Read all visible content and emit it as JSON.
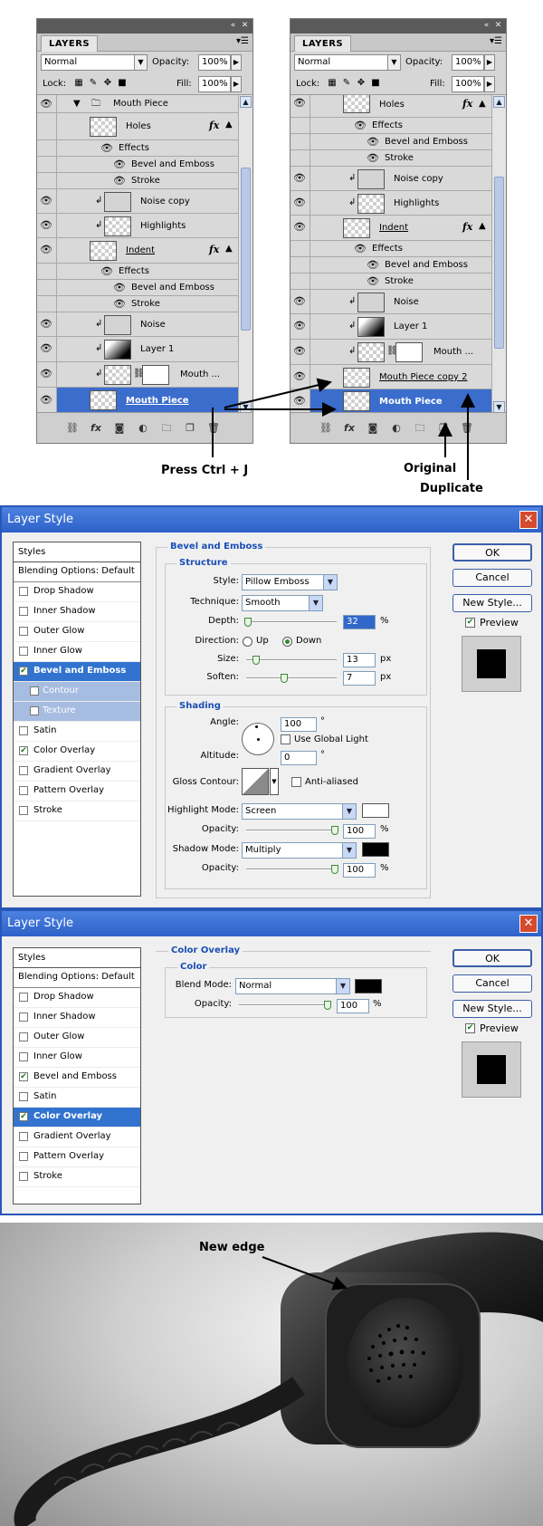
{
  "layers_left": {
    "tab": "LAYERS",
    "blend_mode": "Normal",
    "opacity_label": "Opacity:",
    "opacity_value": "100%",
    "lock_label": "Lock:",
    "fill_label": "Fill:",
    "fill_value": "100%",
    "rows": [
      "Mouth Piece",
      "Holes",
      "Effects",
      "Bevel and Emboss",
      "Stroke",
      "Noise  copy",
      "Highlights",
      "Indent",
      "Effects",
      "Bevel and Emboss",
      "Stroke",
      "Noise",
      "Layer 1",
      "Mouth ...",
      "Mouth Piece"
    ]
  },
  "layers_right": {
    "tab": "LAYERS",
    "blend_mode": "Normal",
    "opacity_label": "Opacity:",
    "opacity_value": "100%",
    "lock_label": "Lock:",
    "fill_label": "Fill:",
    "fill_value": "100%",
    "rows": [
      "Holes",
      "Effects",
      "Bevel and Emboss",
      "Stroke",
      "Noise  copy",
      "Highlights",
      "Indent",
      "Effects",
      "Bevel and Emboss",
      "Stroke",
      "Noise",
      "Layer 1",
      "Mouth ...",
      "Mouth Piece copy 2",
      "Mouth Piece"
    ]
  },
  "annotations": {
    "press": "Press Ctrl + J",
    "original": "Original",
    "duplicate": "Duplicate",
    "new_edge": "New edge"
  },
  "dialog1": {
    "title": "Layer Style",
    "styles_header": "Styles",
    "blending": "Blending Options: Default",
    "items": [
      "Drop Shadow",
      "Inner Shadow",
      "Outer Glow",
      "Inner Glow",
      "Bevel and Emboss",
      "Contour",
      "Texture",
      "Satin",
      "Color Overlay",
      "Gradient Overlay",
      "Pattern Overlay",
      "Stroke"
    ],
    "section": "Bevel and Emboss",
    "structure": "Structure",
    "style_label": "Style:",
    "style_value": "Pillow Emboss",
    "technique_label": "Technique:",
    "technique_value": "Smooth",
    "depth_label": "Depth:",
    "depth_value": "32",
    "pct": "%",
    "direction_label": "Direction:",
    "up": "Up",
    "down": "Down",
    "size_label": "Size:",
    "size_value": "13",
    "px": "px",
    "soften_label": "Soften:",
    "soften_value": "7",
    "shading": "Shading",
    "angle_label": "Angle:",
    "angle_value": "100",
    "deg": "°",
    "global_light": "Use Global Light",
    "altitude_label": "Altitude:",
    "altitude_value": "0",
    "gloss_label": "Gloss Contour:",
    "anti_aliased": "Anti-aliased",
    "highlight_label": "Highlight Mode:",
    "highlight_value": "Screen",
    "opacity_label": "Opacity:",
    "h_opacity": "100",
    "shadow_label": "Shadow Mode:",
    "shadow_value": "Multiply",
    "s_opacity": "100",
    "ok": "OK",
    "cancel": "Cancel",
    "new_style": "New Style...",
    "preview": "Preview"
  },
  "dialog2": {
    "title": "Layer Style",
    "styles_header": "Styles",
    "blending": "Blending Options: Default",
    "items": [
      "Drop Shadow",
      "Inner Shadow",
      "Outer Glow",
      "Inner Glow",
      "Bevel and Emboss",
      "Satin",
      "Color Overlay",
      "Gradient Overlay",
      "Pattern Overlay",
      "Stroke"
    ],
    "section": "Color Overlay",
    "color": "Color",
    "blend_label": "Blend Mode:",
    "blend_value": "Normal",
    "opacity_label": "Opacity:",
    "opacity_value": "100",
    "pct": "%",
    "ok": "OK",
    "cancel": "Cancel",
    "new_style": "New Style...",
    "preview": "Preview"
  },
  "colors": {
    "selection": "#3b6dcd",
    "dialog_title": "#2d61c9",
    "section_title": "#1a4fb5"
  }
}
